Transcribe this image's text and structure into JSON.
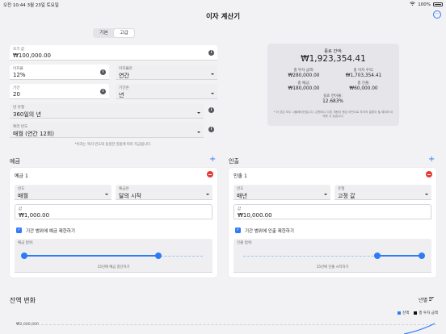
{
  "status_bar": {
    "time_date": "오전 10:44  3월 23일 토요일",
    "battery": "100%"
  },
  "app": {
    "title": "이자 계산기"
  },
  "mode_tabs": [
    {
      "label": "기본",
      "active": false
    },
    {
      "label": "고급",
      "active": true
    }
  ],
  "inputs": {
    "principal": {
      "label": "초기 값",
      "value": "₩100,000.00"
    },
    "rate": {
      "label": "이자율",
      "value": "12%"
    },
    "rate_period": {
      "label": "이자율은",
      "value": "연간"
    },
    "term": {
      "label": "기간",
      "value": "20"
    },
    "term_unit": {
      "label": "기간은",
      "value": "년"
    },
    "day_count": {
      "label": "년 유형",
      "value": "360일의 년"
    },
    "compounding": {
      "label": "복리 빈도",
      "value": "매월 (연간 12회)"
    },
    "footnote": "*이자는 복리 빈도와 동일한 일정에 따라 지급됩니다."
  },
  "result": {
    "final_label": "종료 잔액:",
    "final_value": "₩1,923,354.41",
    "items": [
      {
        "label": "총 투자 금액:",
        "value": "₩280,000.00"
      },
      {
        "label": "총 이자 수익:",
        "value": "₩1,703,354.41"
      },
      {
        "label": "총 예금:",
        "value": "₩180,000.00"
      },
      {
        "label": "총 인출:",
        "value": "₩60,000.00"
      }
    ],
    "yield_label": "실효 연이율:",
    "yield_value": "12.683%",
    "disclaimer": "* 이 것은 모두 시뮬레이션입니다. 은행이나 다른 세팅이 원금 이번으로 투자의 결론이 될 예외와 이 의한 수 있습니다."
  },
  "deposits": {
    "section_title": "예금",
    "card_title": "예금 1",
    "frequency": {
      "label": "빈도",
      "value": "매월"
    },
    "timing": {
      "label": "예금은",
      "value": "달의 시작"
    },
    "amount": {
      "label": "값",
      "value": "₩1,000.00"
    },
    "limit_label": "기간 범위에 예금 제한하기",
    "range_label": "예금 범위:",
    "range_caption": "15년에 예금 중단하기",
    "range": {
      "start": 0,
      "end": 0.75
    }
  },
  "withdrawals": {
    "section_title": "인출",
    "card_title": "인출 1",
    "frequency": {
      "label": "빈도",
      "value": "매년"
    },
    "type": {
      "label": "유형",
      "value": "고정 값"
    },
    "amount": {
      "label": "값",
      "value": "₩10,000.00"
    },
    "limit_label": "기간 범위에 인출 제한하기",
    "range_label": "인출 범위:",
    "range_caption": "15년에 인출 시작하기",
    "range": {
      "start": 0.75,
      "end": 1
    }
  },
  "chart_section": {
    "title": "잔액 변화",
    "period_button": "년별",
    "legend": [
      {
        "name": "잔액",
        "color": "#2f7bf6"
      },
      {
        "name": "총 투자 금액",
        "color": "#111111"
      }
    ],
    "y_tick": "₩2,000,000"
  },
  "colors": {
    "accent": "#2f7bf6",
    "danger": "#e53935"
  }
}
